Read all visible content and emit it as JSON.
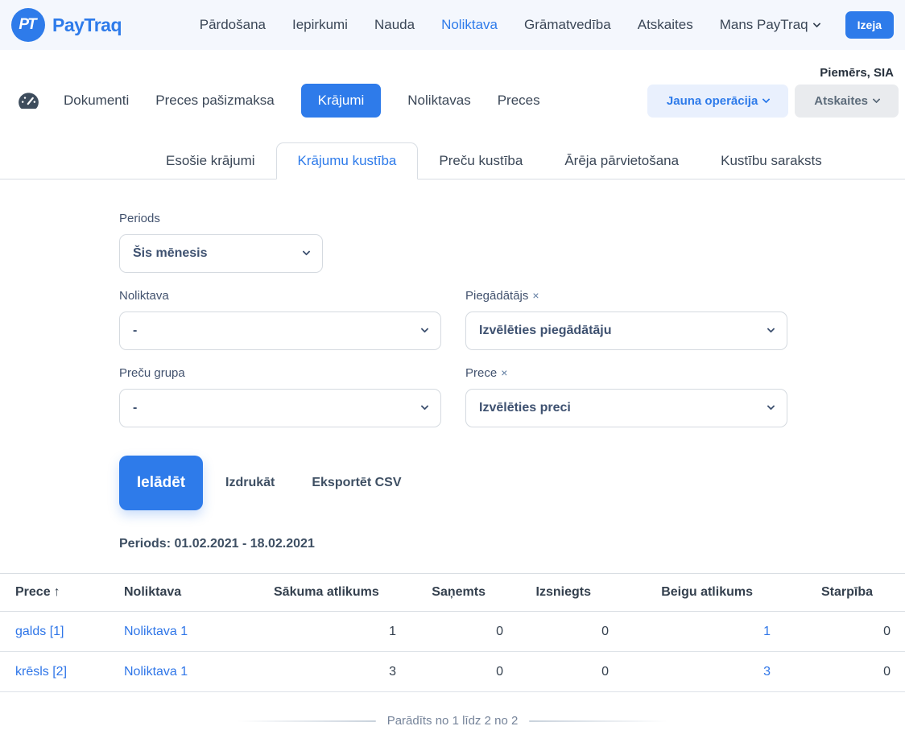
{
  "topnav": {
    "logo_monogram": "PT",
    "logo_text": "PayTraq",
    "items": [
      {
        "label": "Pārdošana",
        "active": false
      },
      {
        "label": "Iepirkumi",
        "active": false
      },
      {
        "label": "Nauda",
        "active": false
      },
      {
        "label": "Noliktava",
        "active": true
      },
      {
        "label": "Grāmatvedība",
        "active": false
      },
      {
        "label": "Atskaites",
        "active": false
      },
      {
        "label": "Mans PayTraq",
        "active": false,
        "has_dropdown": true
      }
    ],
    "logout_label": "Izeja"
  },
  "header": {
    "company": "Piemērs, SIA"
  },
  "module_nav": {
    "items": [
      {
        "label": "Dokumenti",
        "active": false
      },
      {
        "label": "Preces pašizmaksa",
        "active": false
      },
      {
        "label": "Krājumi",
        "active": true
      },
      {
        "label": "Noliktavas",
        "active": false
      },
      {
        "label": "Preces",
        "active": false
      }
    ],
    "actions": {
      "new_operation": "Jauna operācija",
      "reports": "Atskaites"
    }
  },
  "tabs": [
    {
      "label": "Esošie krājumi",
      "active": false
    },
    {
      "label": "Krājumu kustība",
      "active": true
    },
    {
      "label": "Preču kustība",
      "active": false
    },
    {
      "label": "Ārēja pārvietošana",
      "active": false
    },
    {
      "label": "Kustību saraksts",
      "active": false
    }
  ],
  "filters": {
    "period": {
      "label": "Periods",
      "value": "Šis mēnesis"
    },
    "warehouse": {
      "label": "Noliktava",
      "value": "-"
    },
    "supplier": {
      "label": "Piegādātājs",
      "clear_icon": "×",
      "value": "Izvēlēties piegādātāju"
    },
    "product_group": {
      "label": "Preču grupa",
      "value": "-"
    },
    "product": {
      "label": "Prece",
      "clear_icon": "×",
      "value": "Izvēlēties preci"
    }
  },
  "actions": {
    "load": "Ielādēt",
    "print": "Izdrukāt",
    "export_csv": "Eksportēt CSV"
  },
  "period_summary": "Periods: 01.02.2021 - 18.02.2021",
  "table": {
    "columns": [
      "Prece",
      "Noliktava",
      "Sākuma atlikums",
      "Saņemts",
      "Izsniegts",
      "Beigu atlikums",
      "Starpība"
    ],
    "sort": {
      "column": "Prece",
      "indicator": "↑"
    },
    "rows": [
      {
        "cells": [
          "galds [1]",
          "Noliktava 1",
          "1",
          "0",
          "0",
          "1",
          "0"
        ]
      },
      {
        "cells": [
          "krēsls [2]",
          "Noliktava 1",
          "3",
          "0",
          "0",
          "3",
          "0"
        ]
      }
    ]
  },
  "footer": {
    "pagination": "Parādīts no 1 līdz 2 no 2"
  },
  "colors": {
    "accent_blue": "#2e7bea",
    "topbar_bg": "#f4f7fd",
    "soft_blue_btn_bg": "#e9f0fd",
    "soft_gray_btn_bg": "#e9ebee",
    "link_blue": "#2f76e8",
    "text_dark": "#34404e",
    "label_slate": "#42526e",
    "border_gray": "#d8dde3"
  }
}
